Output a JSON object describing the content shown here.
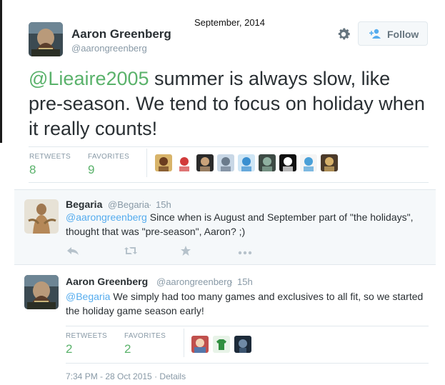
{
  "annotation": "September, 2014",
  "main_tweet": {
    "author_name": "Aaron Greenberg",
    "author_handle": "@aarongreenberg",
    "follow_label": "Follow",
    "mention": "@Lieaire2005",
    "text": " summer is always slow, like pre-season. We tend to focus on holiday when it really counts!",
    "retweets_label": "RETWEETS",
    "retweets": "8",
    "favorites_label": "FAVORITES",
    "favorites": "9",
    "favoriter_count": 9
  },
  "reply1": {
    "author_name": "Begaria",
    "author_handle": "@Begaria",
    "sep": "·",
    "time": "15h",
    "mention": "@aarongreenberg",
    "text": " Since when is August and September part of \"the holidays\", thought that was \"pre-season\", Aaron? ;)"
  },
  "reply2": {
    "author_name": "Aaron Greenberg",
    "author_handle": "@aarongreenberg",
    "sep": "·",
    "time": "15h",
    "mention": "@Begaria",
    "text": " We simply had too many games and exclusives to all fit, so we started the holiday game season early!",
    "retweets_label": "RETWEETS",
    "retweets": "2",
    "favorites_label": "FAVORITES",
    "favorites": "2",
    "timestamp": "7:34 PM - 28 Oct 2015",
    "sep2": "·",
    "details_label": "Details"
  },
  "icons": {
    "gear": "gear-icon",
    "follow": "add-user-icon",
    "reply": "reply-icon",
    "retweet": "retweet-icon",
    "favorite": "star-icon",
    "more": "more-icon"
  },
  "colors": {
    "mention_blue": "#55acee",
    "stat_green": "#5ab26b",
    "muted": "#8899a6",
    "reply_bg": "#f5f8fa"
  }
}
